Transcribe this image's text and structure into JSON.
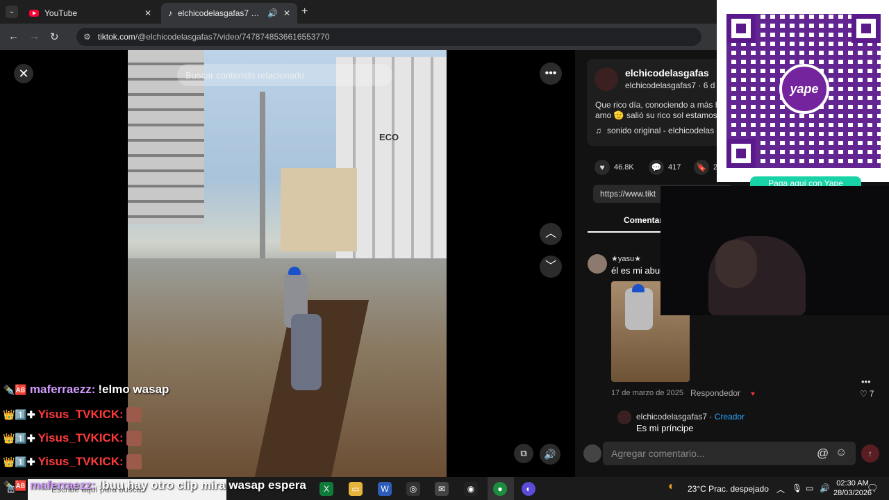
{
  "browser": {
    "tabs": [
      {
        "title": "YouTube",
        "close": "✕"
      },
      {
        "title": "elchicodelasgafas7 (@elchi",
        "close": "✕"
      }
    ],
    "new_tab": "+",
    "url_host": "tiktok.com",
    "url_path": "/@elchicodelasgafas7/video/7478748536616553770"
  },
  "video": {
    "search_placeholder": "Buscar contenido relacionado",
    "sign_text": "ECO"
  },
  "post": {
    "display_name": "elchicodelasgafas",
    "handle_line": "elchicodelasgafas7 · 6 d",
    "caption_line1": "Que rico día, conociendo a más h",
    "caption_line2": "amo 🫡 salió su rico sol estamos a",
    "sound": "sonido original - elchicodelas",
    "likes": "46.8K",
    "comments_count": "417",
    "saves": "2",
    "share_link": "https://www.tikt"
  },
  "comments": {
    "tab_label": "Comentar",
    "item": {
      "user": "★yasu★",
      "text": "él es mi abue",
      "date": "17 de marzo de 2025",
      "reply": "Respondedor",
      "likes": "7"
    },
    "reply_item": {
      "user": "elchicodelasgafas7",
      "sep": " · ",
      "role": "Creador",
      "text": "Es mi príncipe"
    },
    "input_placeholder": "Agregar comentario..."
  },
  "qr": {
    "logo_text": "yape",
    "caption": "Paga aquí con Yape"
  },
  "chat": [
    {
      "badge": "✒️🆎",
      "user": "maferraezz:",
      "message": "!elmo wasap",
      "color": "#d39bff"
    },
    {
      "badge": "👑1️⃣✚",
      "user": "Yisus_TVKICK:",
      "message": "",
      "color": "#ff3a3a"
    },
    {
      "badge": "👑1️⃣✚",
      "user": "Yisus_TVKICK:",
      "message": "",
      "color": "#ff3a3a"
    },
    {
      "badge": "👑1️⃣✚",
      "user": "Yisus_TVKICK:",
      "message": "",
      "color": "#ff3a3a"
    },
    {
      "badge": "✒️🆎",
      "user": "maferraezz:",
      "message": "!buu hay otro clip mira wasap espera",
      "color": "#d39bff"
    }
  ],
  "taskbar": {
    "search_text": "Escribe aquí para buscar",
    "weather": "23°C  Prac. despejado",
    "time": "02:30 AM",
    "date": "28/03/2026"
  }
}
